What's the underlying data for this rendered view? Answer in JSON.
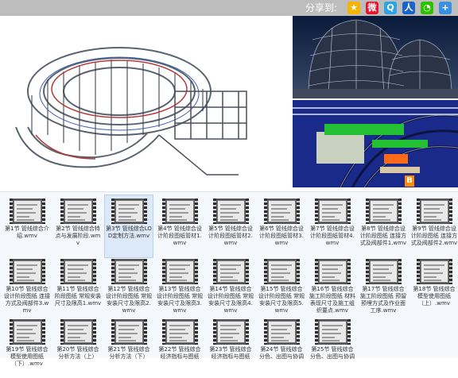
{
  "share": {
    "label": "分享到:",
    "icons": [
      {
        "name": "qzone-icon",
        "color": "#f4b400",
        "glyph": "★"
      },
      {
        "name": "weibo-icon",
        "color": "#e6162d",
        "glyph": "微"
      },
      {
        "name": "qq-icon",
        "color": "#2aa4e6",
        "glyph": "Q"
      },
      {
        "name": "renren-icon",
        "color": "#1a64c8",
        "glyph": "人"
      },
      {
        "name": "wechat-icon",
        "color": "#2dc100",
        "glyph": "◔"
      },
      {
        "name": "more-icon",
        "color": "#3b8fe0",
        "glyph": "+"
      }
    ]
  },
  "colors": {
    "list_bg": "#f5f8fc",
    "selected_bg": "#dbe9f8",
    "sharebar_bg": "#bdbdbd"
  },
  "files": [
    {
      "label": "第1节 管线综合介绍.wmv",
      "selected": false
    },
    {
      "label": "第2节 管线综合特点与发展阶段.wmv",
      "selected": false
    },
    {
      "label": "第3节 管线综合LOD定制方法.wmv",
      "selected": true
    },
    {
      "label": "第4节 管线综合设计阶段图纸管材1.wmv",
      "selected": false
    },
    {
      "label": "第5节 管线综合设计阶段图纸管材2.wmv",
      "selected": false
    },
    {
      "label": "第6节 管线综合设计阶段图纸管材3.wmv",
      "selected": false
    },
    {
      "label": "第7节 管线综合设计阶段图纸管材4.wmv",
      "selected": false
    },
    {
      "label": "第8节 管线综合设计阶段图纸 连接方式及阀部件1.wmv",
      "selected": false
    },
    {
      "label": "第9节 管线综合设计阶段图纸 连接方式及阀部件2.wmv",
      "selected": false
    },
    {
      "label": "第10节 管线综合设计阶段图纸 连接方式及阀部件3.wmv",
      "selected": false
    },
    {
      "label": "第11节 管线综合阶段图纸 常规安装尺寸及限高1.wmv",
      "selected": false
    },
    {
      "label": "第12节 管线综合设计阶段图纸 常规安装尺寸及限高2.wmv",
      "selected": false
    },
    {
      "label": "第13节 管线综合设计阶段图纸 常规安装尺寸及限高3.wmv",
      "selected": false
    },
    {
      "label": "第14节 管线综合设计阶段图纸 常规安装尺寸及限高4.wmv",
      "selected": false
    },
    {
      "label": "第15节 管线综合设计阶段图纸 常规安装尺寸及限高5.wmv",
      "selected": false
    },
    {
      "label": "第16节 管线综合施工阶段图纸 材料表现尺寸及施工组织要点.wmv",
      "selected": false
    },
    {
      "label": "第17节 管线综合施工阶段图纸 预留预埋方式及作业面工序.wmv",
      "selected": false
    },
    {
      "label": "第18节 管线综合模型使用图纸（上）.wmv",
      "selected": false
    },
    {
      "label": "第19节 管线综合模型使用图纸（下）.wmv",
      "selected": false
    },
    {
      "label": "第20节 管线综合分析方法（上）",
      "selected": false
    },
    {
      "label": "第21节 管线综合分析方法（下）",
      "selected": false
    },
    {
      "label": "第22节 管线综合经济指标与图纸",
      "selected": false
    },
    {
      "label": "第23节 管线综合经济指标与图纸",
      "selected": false
    },
    {
      "label": "第24节 管线综合分色、出图与协调",
      "selected": false
    },
    {
      "label": "第25节 管线综合分色、出图与协调",
      "selected": false
    }
  ]
}
